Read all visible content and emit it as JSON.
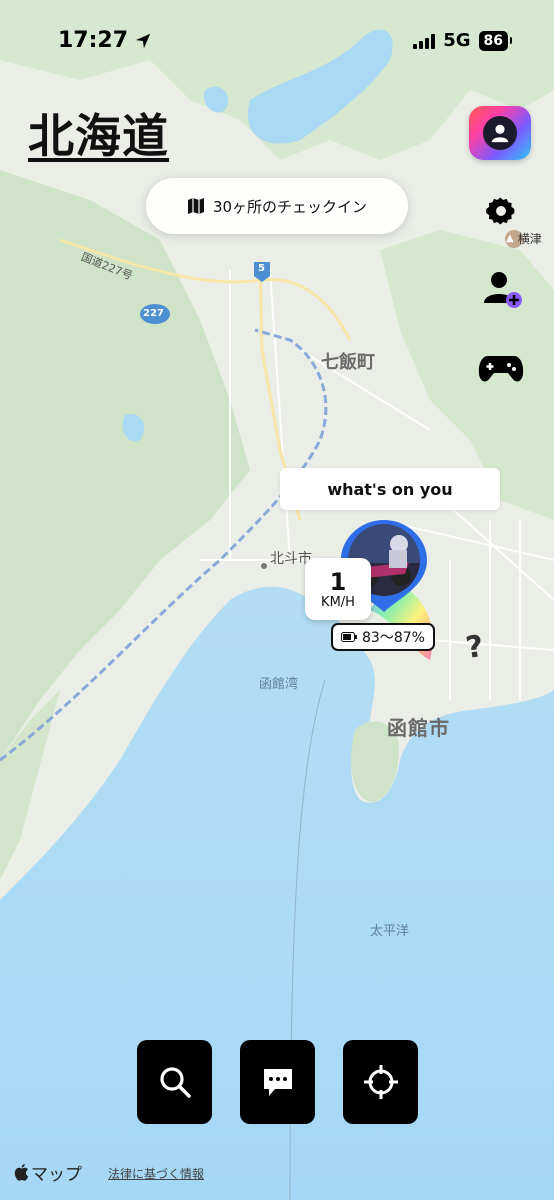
{
  "status_bar": {
    "time": "17:27",
    "network": "5G",
    "battery_level": "86",
    "icons": [
      "location-arrow-icon",
      "cellular-signal-icon",
      "battery-icon"
    ]
  },
  "region_title": "北海道",
  "checkin": {
    "icon": "map-icon",
    "label": "30ヶ所のチェックイン"
  },
  "side_buttons": [
    {
      "name": "profile-button",
      "icon": "person-icon"
    },
    {
      "name": "settings-button",
      "icon": "gear-icon"
    },
    {
      "name": "add-friend-button",
      "icon": "add-user-icon"
    },
    {
      "name": "game-button",
      "icon": "gamepad-icon"
    }
  ],
  "map_labels": {
    "route_227": "国道227号",
    "route_badge_5": "5",
    "route_badge_227": "227",
    "town": "七飯町",
    "hokuto": "北斗市",
    "bay": "函館湾",
    "city": "函館市",
    "ocean": "太平洋",
    "poi_partial": "横津"
  },
  "status_card": "what's on you",
  "speed": {
    "value": "1",
    "unit": "KM/H"
  },
  "battery_badge": "83～87%",
  "unknown_marker": "?",
  "bottom_buttons": [
    {
      "name": "search-button",
      "icon": "search-icon"
    },
    {
      "name": "chat-button",
      "icon": "chat-bubble-icon"
    },
    {
      "name": "locate-button",
      "icon": "crosshair-icon"
    }
  ],
  "footer": {
    "maps_label": "マップ",
    "legal_link": "法律に基づく情報"
  },
  "colors": {
    "land": "#e9eee6",
    "forest": "#cfe3c8",
    "water": "#a9d9f3",
    "accent_gradient": [
      "#ff5a4f",
      "#ff3fa4",
      "#7b5cff",
      "#2fc5f5"
    ]
  }
}
